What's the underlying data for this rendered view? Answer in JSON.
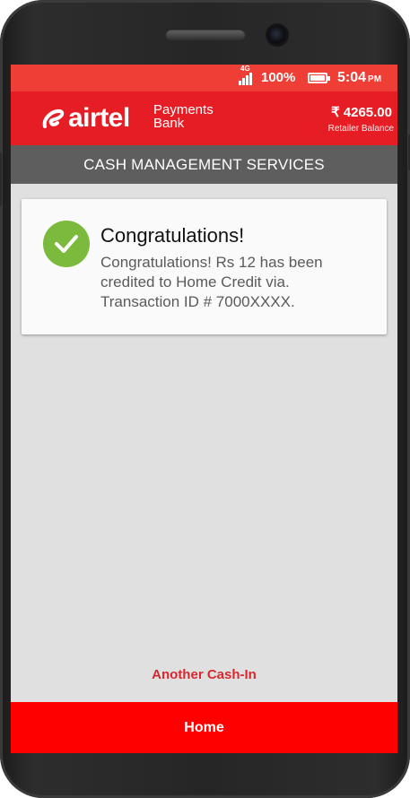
{
  "status_bar": {
    "network": "4G",
    "battery_percent": "100%",
    "time": "5:04",
    "time_suffix": "PM"
  },
  "app_bar": {
    "logo_word": "airtel",
    "logo_sub_line1": "Payments",
    "logo_sub_line2": "Bank",
    "balance": "₹ 4265.00",
    "balance_label": "Retailer Balance"
  },
  "subheader": {
    "title": "CASH MANAGEMENT SERVICES"
  },
  "card": {
    "title": "Congratulations!",
    "message": "Congratulations! Rs 12 has been credited to Home Credit via. Transaction ID # 7000XXXX.",
    "icon": "check-circle-icon"
  },
  "actions": {
    "another_cash_in": "Another Cash-In",
    "home": "Home"
  },
  "colors": {
    "status_bar": "#ef3e36",
    "app_bar": "#e61d25",
    "subheader": "#5e5e5e",
    "success": "#7cba3e",
    "home_button": "#ff0000"
  }
}
